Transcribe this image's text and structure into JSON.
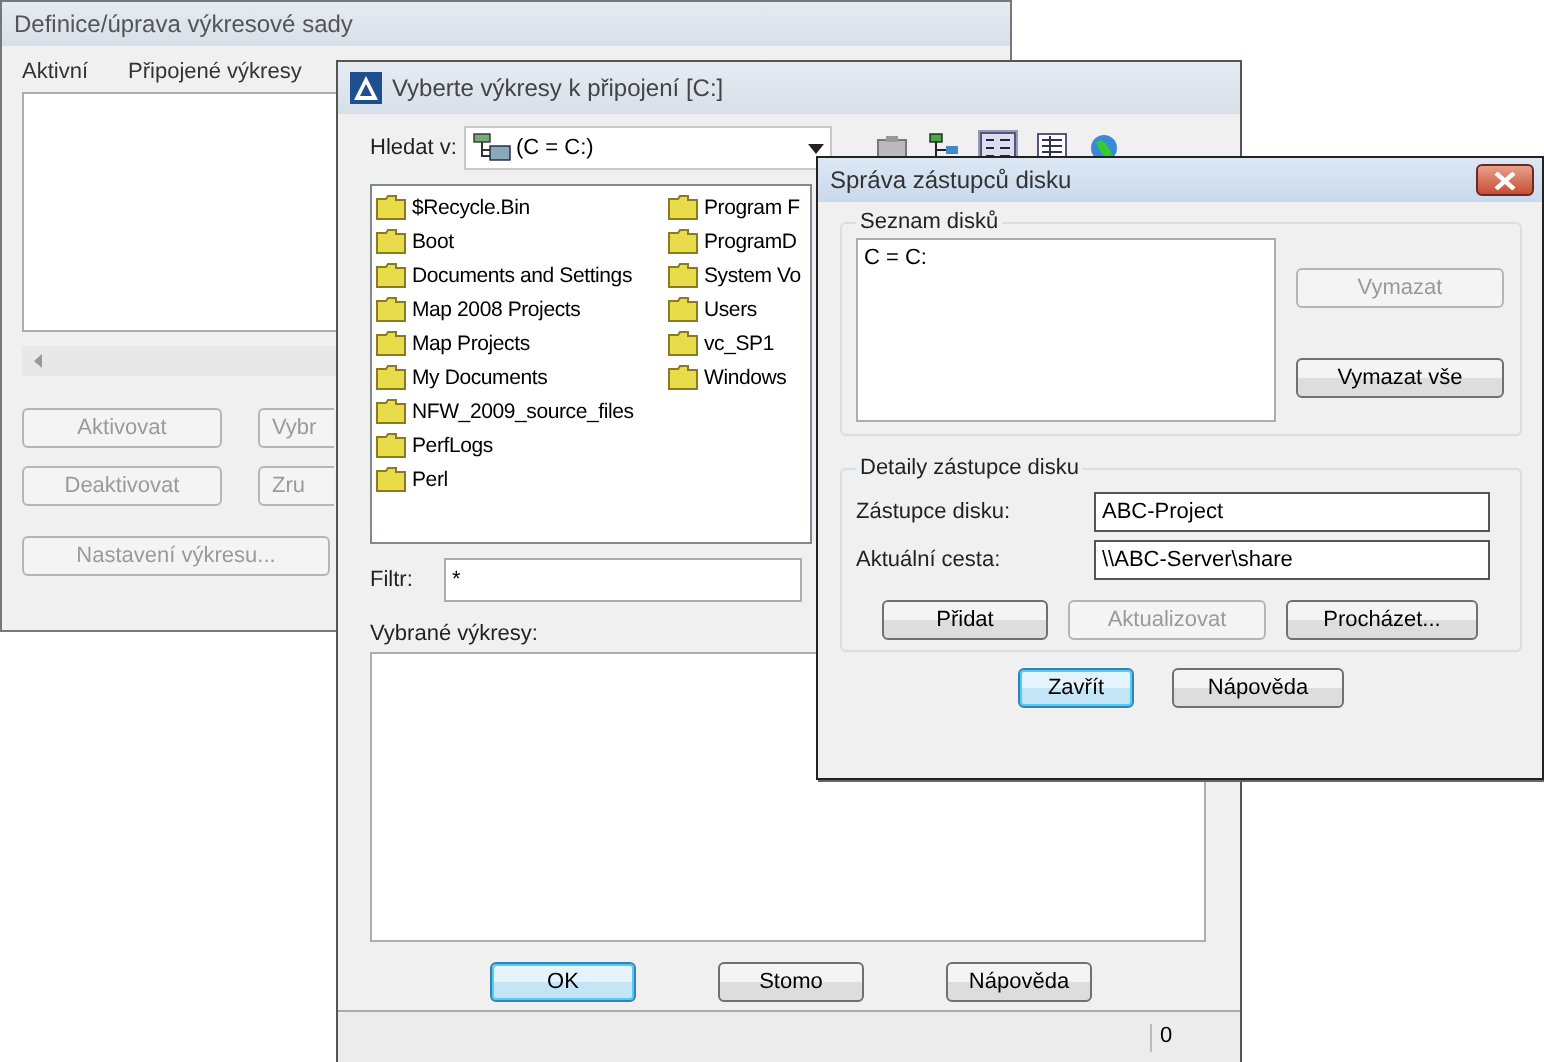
{
  "back_window": {
    "title": "Definice/úprava výkresové sady",
    "columns": [
      "Aktivní",
      "Připojené výkresy"
    ],
    "buttons": [
      {
        "label": "Aktivovat",
        "disabled": true
      },
      {
        "label": "Vybr",
        "disabled": true
      },
      {
        "label": "Deaktivovat",
        "disabled": true
      },
      {
        "label": "Zru",
        "disabled": true
      }
    ],
    "settings_button": {
      "label": "Nastavení výkresu...",
      "disabled": true
    }
  },
  "attach_dialog": {
    "title": "Vyberte výkresy k připojení [C:]",
    "look_in": {
      "label": "Hledat v:",
      "value": "(C = C:)"
    },
    "folders": [
      "$Recycle.Bin",
      "Boot",
      "Documents and Settings",
      "Map 2008 Projects",
      "Map Projects",
      "My Documents",
      "NFW_2009_source_files",
      "PerfLogs",
      "Perl",
      "Program F",
      "ProgramD",
      "System Vo",
      "Users",
      "vc_SP1",
      "Windows"
    ],
    "filter": {
      "label": "Filtr:",
      "value": "*"
    },
    "selected_label": "Vybrané výkresy:",
    "buttons": [
      {
        "label": "OK",
        "default": true,
        "disabled": false
      },
      {
        "label": "Stomo",
        "default": false,
        "disabled": false
      },
      {
        "label": "Nápověda",
        "default": false,
        "disabled": false
      }
    ],
    "status_count": "0"
  },
  "alias_dialog": {
    "title": "Správa zástupců disku",
    "list_group": {
      "title": "Seznam disků",
      "items": [
        "C = C:"
      ],
      "buttons": [
        {
          "label": "Vymazat",
          "default": false,
          "disabled": true
        },
        {
          "label": "Vymazat vše",
          "default": false,
          "disabled": false
        }
      ]
    },
    "details_group": {
      "title": "Detaily zástupce disku",
      "fields": [
        {
          "label": "Zástupce disku:",
          "value": "ABC-Project"
        },
        {
          "label": "Aktuální cesta:",
          "value": "\\\\ABC-Server\\share"
        }
      ],
      "buttons": [
        {
          "label": "Přidat",
          "default": false,
          "disabled": false
        },
        {
          "label": "Aktualizovat",
          "default": false,
          "disabled": true
        },
        {
          "label": "Procházet...",
          "default": false,
          "disabled": false
        }
      ]
    },
    "buttons": [
      {
        "label": "Zavřít",
        "default": true,
        "disabled": false
      },
      {
        "label": "Nápověda",
        "default": false,
        "disabled": false
      }
    ]
  }
}
